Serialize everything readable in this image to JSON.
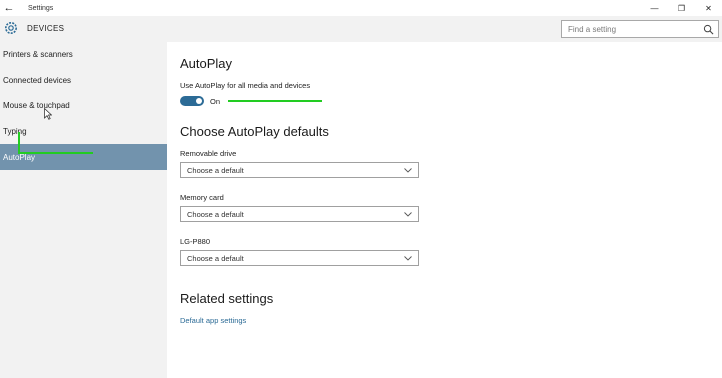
{
  "titlebar": {
    "back_glyph": "←",
    "title": "Settings",
    "minimize_glyph": "—",
    "maximize_glyph": "❐",
    "close_glyph": "✕"
  },
  "header": {
    "section": "DEVICES",
    "search_placeholder": "Find a setting"
  },
  "sidebar": {
    "items": [
      {
        "label": "Printers & scanners"
      },
      {
        "label": "Connected devices"
      },
      {
        "label": "Mouse & touchpad"
      },
      {
        "label": "Typing"
      },
      {
        "label": "AutoPlay"
      }
    ],
    "selected": "AutoPlay"
  },
  "main": {
    "title": "AutoPlay",
    "toggle_label": "Use AutoPlay for all media and devices",
    "toggle_state": "On",
    "defaults_title": "Choose AutoPlay defaults",
    "devices": [
      {
        "label": "Removable drive",
        "value": "Choose a default"
      },
      {
        "label": "Memory card",
        "value": "Choose a default"
      },
      {
        "label": "LG-P880",
        "value": "Choose a default"
      }
    ],
    "related_title": "Related settings",
    "related_link": "Default app settings"
  },
  "colors": {
    "accent": "#2c6b96",
    "selected_bg": "#7293ad",
    "annotation": "#22cc22"
  }
}
